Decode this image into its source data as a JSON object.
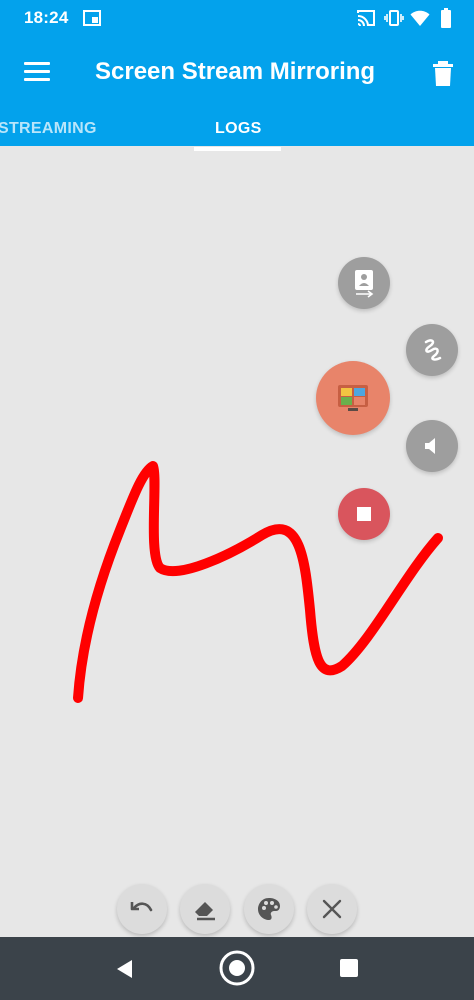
{
  "status_bar": {
    "time": "18:24",
    "left_icons": [
      "screenshot-notification-icon"
    ],
    "right_icons": [
      "cast-icon",
      "vibrate-icon",
      "wifi-icon",
      "battery-icon"
    ]
  },
  "app_bar": {
    "title": "Screen Stream Mirroring",
    "menu_icon": "hamburger-menu-icon",
    "action_icon": "trash-icon"
  },
  "tabs": [
    {
      "label": "STREAMING",
      "active": false
    },
    {
      "label": "LOGS",
      "active": true
    }
  ],
  "floating_menu": {
    "items": [
      "camera-overlay-icon",
      "draw-icon",
      "app-logo-icon",
      "volume-icon",
      "stop-icon"
    ],
    "colors": {
      "gray": "#9e9e9e",
      "main": "#e8846a",
      "stop": "#d9555d"
    }
  },
  "drawing": {
    "stroke_color": "#ff0000"
  },
  "draw_toolbar": {
    "buttons": [
      "undo-icon",
      "eraser-icon",
      "palette-icon",
      "close-icon"
    ]
  },
  "nav_bar": {
    "buttons": [
      "back-icon",
      "home-icon",
      "recents-icon"
    ]
  },
  "colors": {
    "primary": "#03a2ec",
    "canvas_bg": "#e7e7e7",
    "nav_bg": "#3b434a"
  }
}
